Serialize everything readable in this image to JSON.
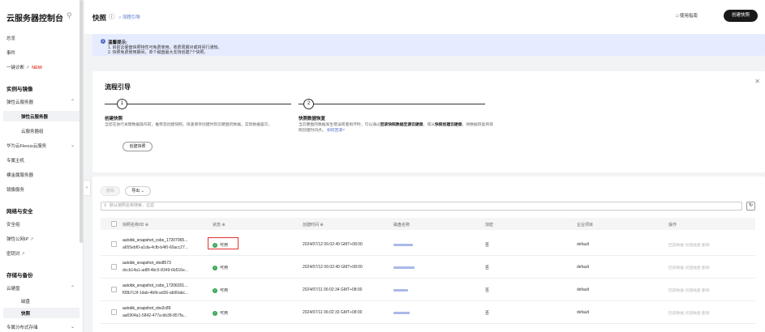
{
  "sidebar": {
    "title": "云服务器控制台",
    "items_top": [
      "总览",
      "事件",
      "一键诊断"
    ],
    "new_badge": "NEW",
    "group1": "实例与镜像",
    "ecs": "弹性云服务器",
    "ecs_sub": [
      "弹性云服务器",
      "云服务器组"
    ],
    "flexus": "华为云Flexus云服务",
    "host": "专属主机",
    "bms": "裸金属服务器",
    "ims": "镜像服务",
    "group2": "网络与安全",
    "net_items": [
      "安全组",
      "弹性公网IP",
      "密钥对"
    ],
    "group3": "存储与备份",
    "evs": "云硬盘",
    "evs_sub": [
      "磁盘",
      "快照"
    ],
    "dss": "专属分布式存储"
  },
  "header": {
    "title": "快照",
    "guide_link": "流程引导",
    "usage_guide": "使用指南",
    "create_button": "创建快照"
  },
  "tip": {
    "title": "温馨提示:",
    "line1": "1. 目前云硬盘快照特性可免费使用，收费周期对或将另行通知。",
    "line2": "2. 快照免费使用期间，单个磁盘最大支持创建7个快照。"
  },
  "guide": {
    "title": "流程引导",
    "step1_num": "1",
    "step1_title": "创建快照",
    "step1_desc": "当您在进行关键数据操作前，推荐您创建快照，快速保存创建时刻云硬盘的数据，实现数据容灾。",
    "step1_button": "创建快照",
    "step2_num": "2",
    "step2_title": "快照数据恢复",
    "step2_desc_a": "当云硬盘的数据发生错误或者损坏时，可以通过",
    "step2_desc_b": "回滚快照数据至源云硬盘",
    "step2_desc_c": "，或从",
    "step2_desc_d": "快照创建云硬盘",
    "step2_desc_e": "，将数据恢复到快照创建时间点。",
    "step2_link": "如何回滚?"
  },
  "toolbar": {
    "delete": "删除",
    "export": "导出",
    "search_placeholder": "默认按照名称搜索、过滤"
  },
  "table": {
    "headers": [
      "快照名称/ID",
      "状态",
      "创建时间",
      "磁盘名称",
      "加密",
      "企业项目",
      "操作"
    ],
    "rows": [
      {
        "name": "autobk_snapshot_csbs_17207065...",
        "id": "a655ebf0-a1da-4cfb-b4f0-60acc27...",
        "status": "可用",
        "created": "2024/07/12 06:02:40 GMT+08:00",
        "encrypt": "否",
        "project": "default",
        "ops": "回滚数据  创建磁盘  删除"
      },
      {
        "name": "autobk_snapshot_vbs8573",
        "id": "dccb14a1-ad8f-4bc5-8349-6b516e...",
        "status": "可用",
        "created": "2024/07/12 06:02:40 GMT+08:00",
        "encrypt": "否",
        "project": "default",
        "ops": "回滚数据  创建磁盘  删除"
      },
      {
        "name": "autobk_snapshot_csbs_17206201...",
        "id": "f08b7c3f-1dab-4bfd-ad36-ab90abc...",
        "status": "可用",
        "created": "2024/07/11 06:02:34 GMT+08:00",
        "encrypt": "否",
        "project": "default",
        "ops": "回滚数据  创建磁盘  删除"
      },
      {
        "name": "autobk_snapshot_vbs2c85",
        "id": "aa6904a1-5842-477a-bb38-857fa...",
        "status": "可用",
        "created": "2024/07/11 06:02:33 GMT+08:00",
        "encrypt": "否",
        "project": "default",
        "ops": "回滚数据  创建磁盘  删除"
      }
    ]
  },
  "colors": {
    "accent": "#526ecc",
    "success": "#3aa655",
    "highlight": "#e0322f",
    "primary_btn": "#191919"
  }
}
